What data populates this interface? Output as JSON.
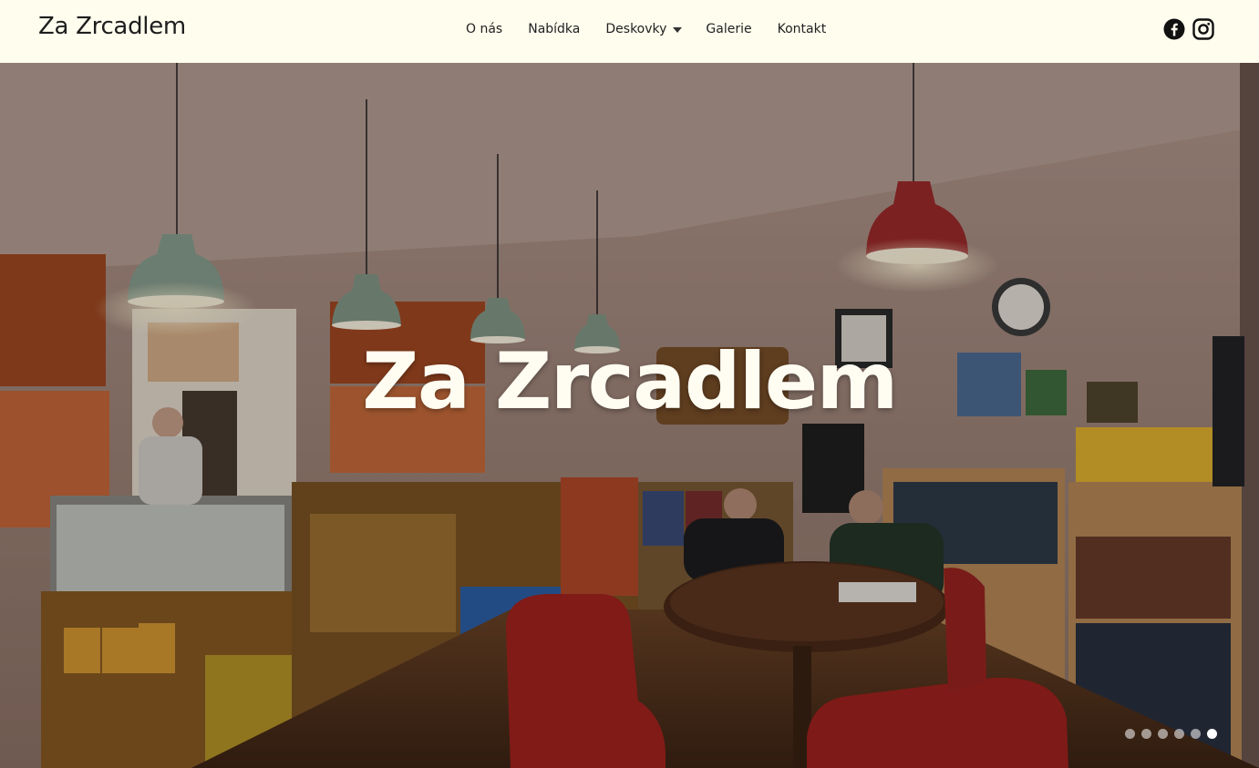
{
  "header": {
    "brand": "Za Zrcadlem",
    "nav": [
      {
        "label": "O nás"
      },
      {
        "label": "Nabídka"
      },
      {
        "label": "Deskovky"
      },
      {
        "label": "Galerie"
      },
      {
        "label": "Kontakt"
      }
    ],
    "social": [
      "facebook-icon",
      "instagram-icon"
    ]
  },
  "hero": {
    "title": "Za Zrcadlem",
    "slides_count": 6,
    "active_slide": 6
  },
  "colors": {
    "header_bg": "#fffdee",
    "text": "#222222",
    "hero_title": "#fffdf2"
  }
}
